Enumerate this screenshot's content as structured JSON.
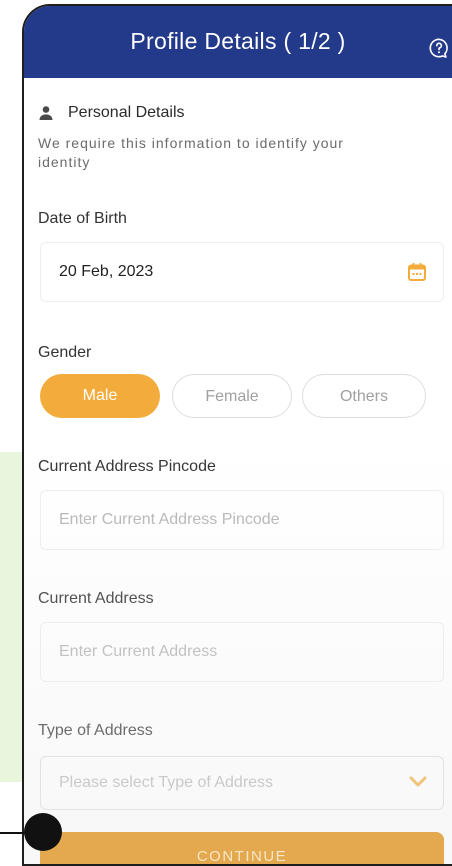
{
  "header": {
    "title": "Profile Details ( 1/2 )"
  },
  "section": {
    "title": "Personal Details",
    "subtitle": "We require this information to identify your identity"
  },
  "dob": {
    "label": "Date of Birth",
    "value": "20 Feb, 2023"
  },
  "gender": {
    "label": "Gender",
    "options": [
      "Male",
      "Female",
      "Others"
    ],
    "selected": "Male"
  },
  "pincode": {
    "label": "Current Address Pincode",
    "placeholder": "Enter Current Address Pincode"
  },
  "address": {
    "label": "Current Address",
    "placeholder": "Enter Current Address"
  },
  "address_type": {
    "label": "Type of Address",
    "placeholder": "Please select Type of Address"
  },
  "footer": {
    "continue_label": "CONTINUE"
  },
  "colors": {
    "header_bg": "#233a8b",
    "accent": "#f3ac3c",
    "page_side_bg": "#eaf5dd"
  }
}
